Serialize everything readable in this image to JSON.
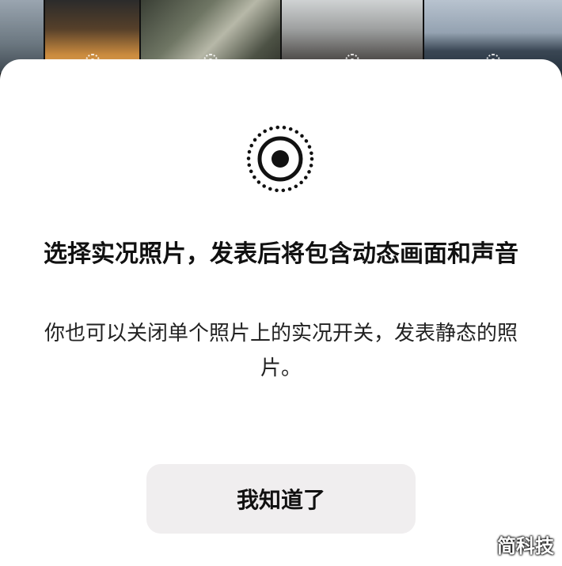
{
  "dialog": {
    "title": "选择实况照片，发表后将包含动态画面和声音",
    "description": "你也可以关闭单个照片上的实况开关，发表静态的照片。",
    "confirm_label": "我知道了",
    "icon": "live-photo-icon"
  },
  "watermark": {
    "text": "简科技"
  },
  "background": {
    "thumbnails": [
      {
        "name": "photo-thumbnail-1",
        "live": false
      },
      {
        "name": "photo-thumbnail-2",
        "live": true
      },
      {
        "name": "photo-thumbnail-3",
        "live": true
      },
      {
        "name": "photo-thumbnail-4",
        "live": true
      },
      {
        "name": "photo-thumbnail-5",
        "live": true
      }
    ]
  },
  "colors": {
    "sheet_background": "#ffffff",
    "button_background": "#f0eeef",
    "text_primary": "#111111"
  }
}
